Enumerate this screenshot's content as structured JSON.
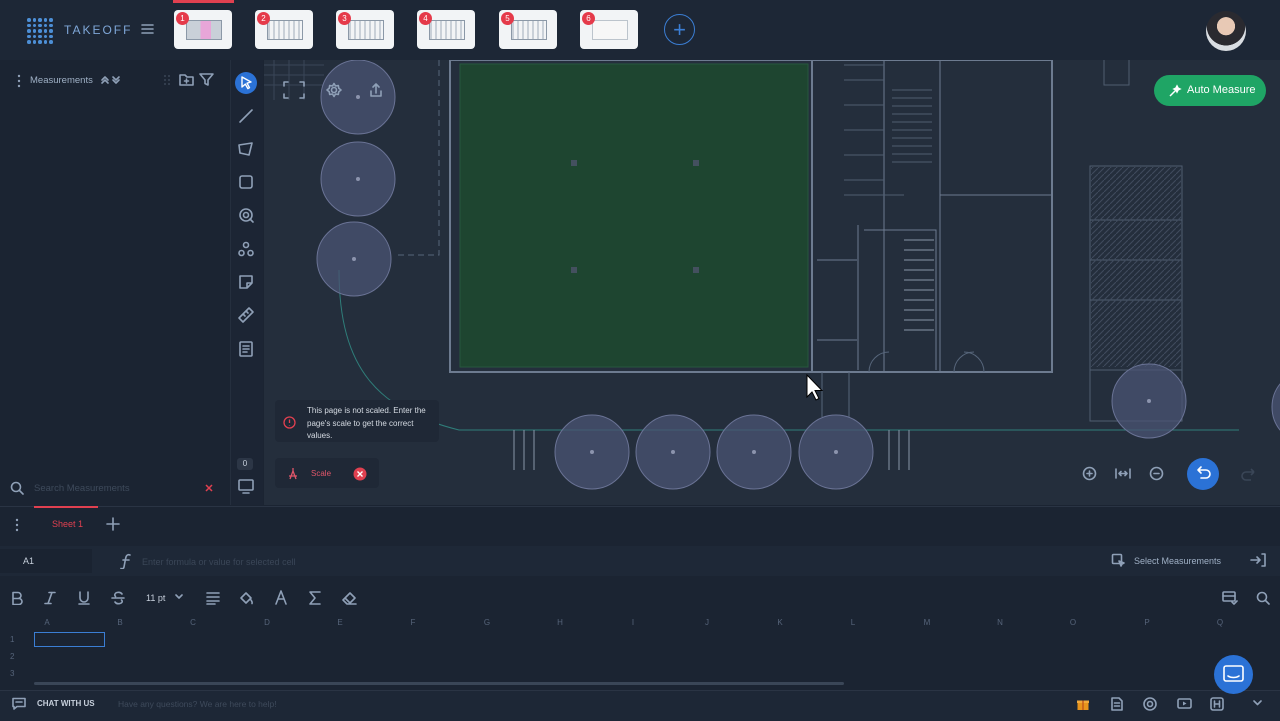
{
  "app": {
    "name": "TAKEOFF"
  },
  "pages": [
    {
      "number": "1"
    },
    {
      "number": "2"
    },
    {
      "number": "3"
    },
    {
      "number": "4"
    },
    {
      "number": "5"
    },
    {
      "number": "6"
    }
  ],
  "colors": {
    "accent": "#2b72d6",
    "danger": "#e04050",
    "success": "#1fa565",
    "canvas_fill": "#1e4530"
  },
  "sidebar": {
    "title": "Measurements",
    "search_placeholder": "Search Measurements",
    "count": "0"
  },
  "canvas": {
    "notice": "This page is not scaled. Enter the page's scale to get the correct values.",
    "scale_label": "Scale",
    "auto_measure_label": "Auto Measure"
  },
  "sheet": {
    "tab_label": "Sheet 1",
    "cell_ref": "A1",
    "formula_placeholder": "Enter formula or value for selected cell",
    "select_measurements_label": "Select Measurements",
    "font_size": "11 pt",
    "columns": [
      "A",
      "B",
      "C",
      "D",
      "E",
      "F",
      "G",
      "H",
      "I",
      "J",
      "K",
      "L",
      "M",
      "N",
      "O",
      "P",
      "Q"
    ],
    "rows": [
      "1",
      "2",
      "3"
    ]
  },
  "chat": {
    "label": "CHAT WITH US",
    "placeholder": "Have any questions? We are here to help!"
  }
}
